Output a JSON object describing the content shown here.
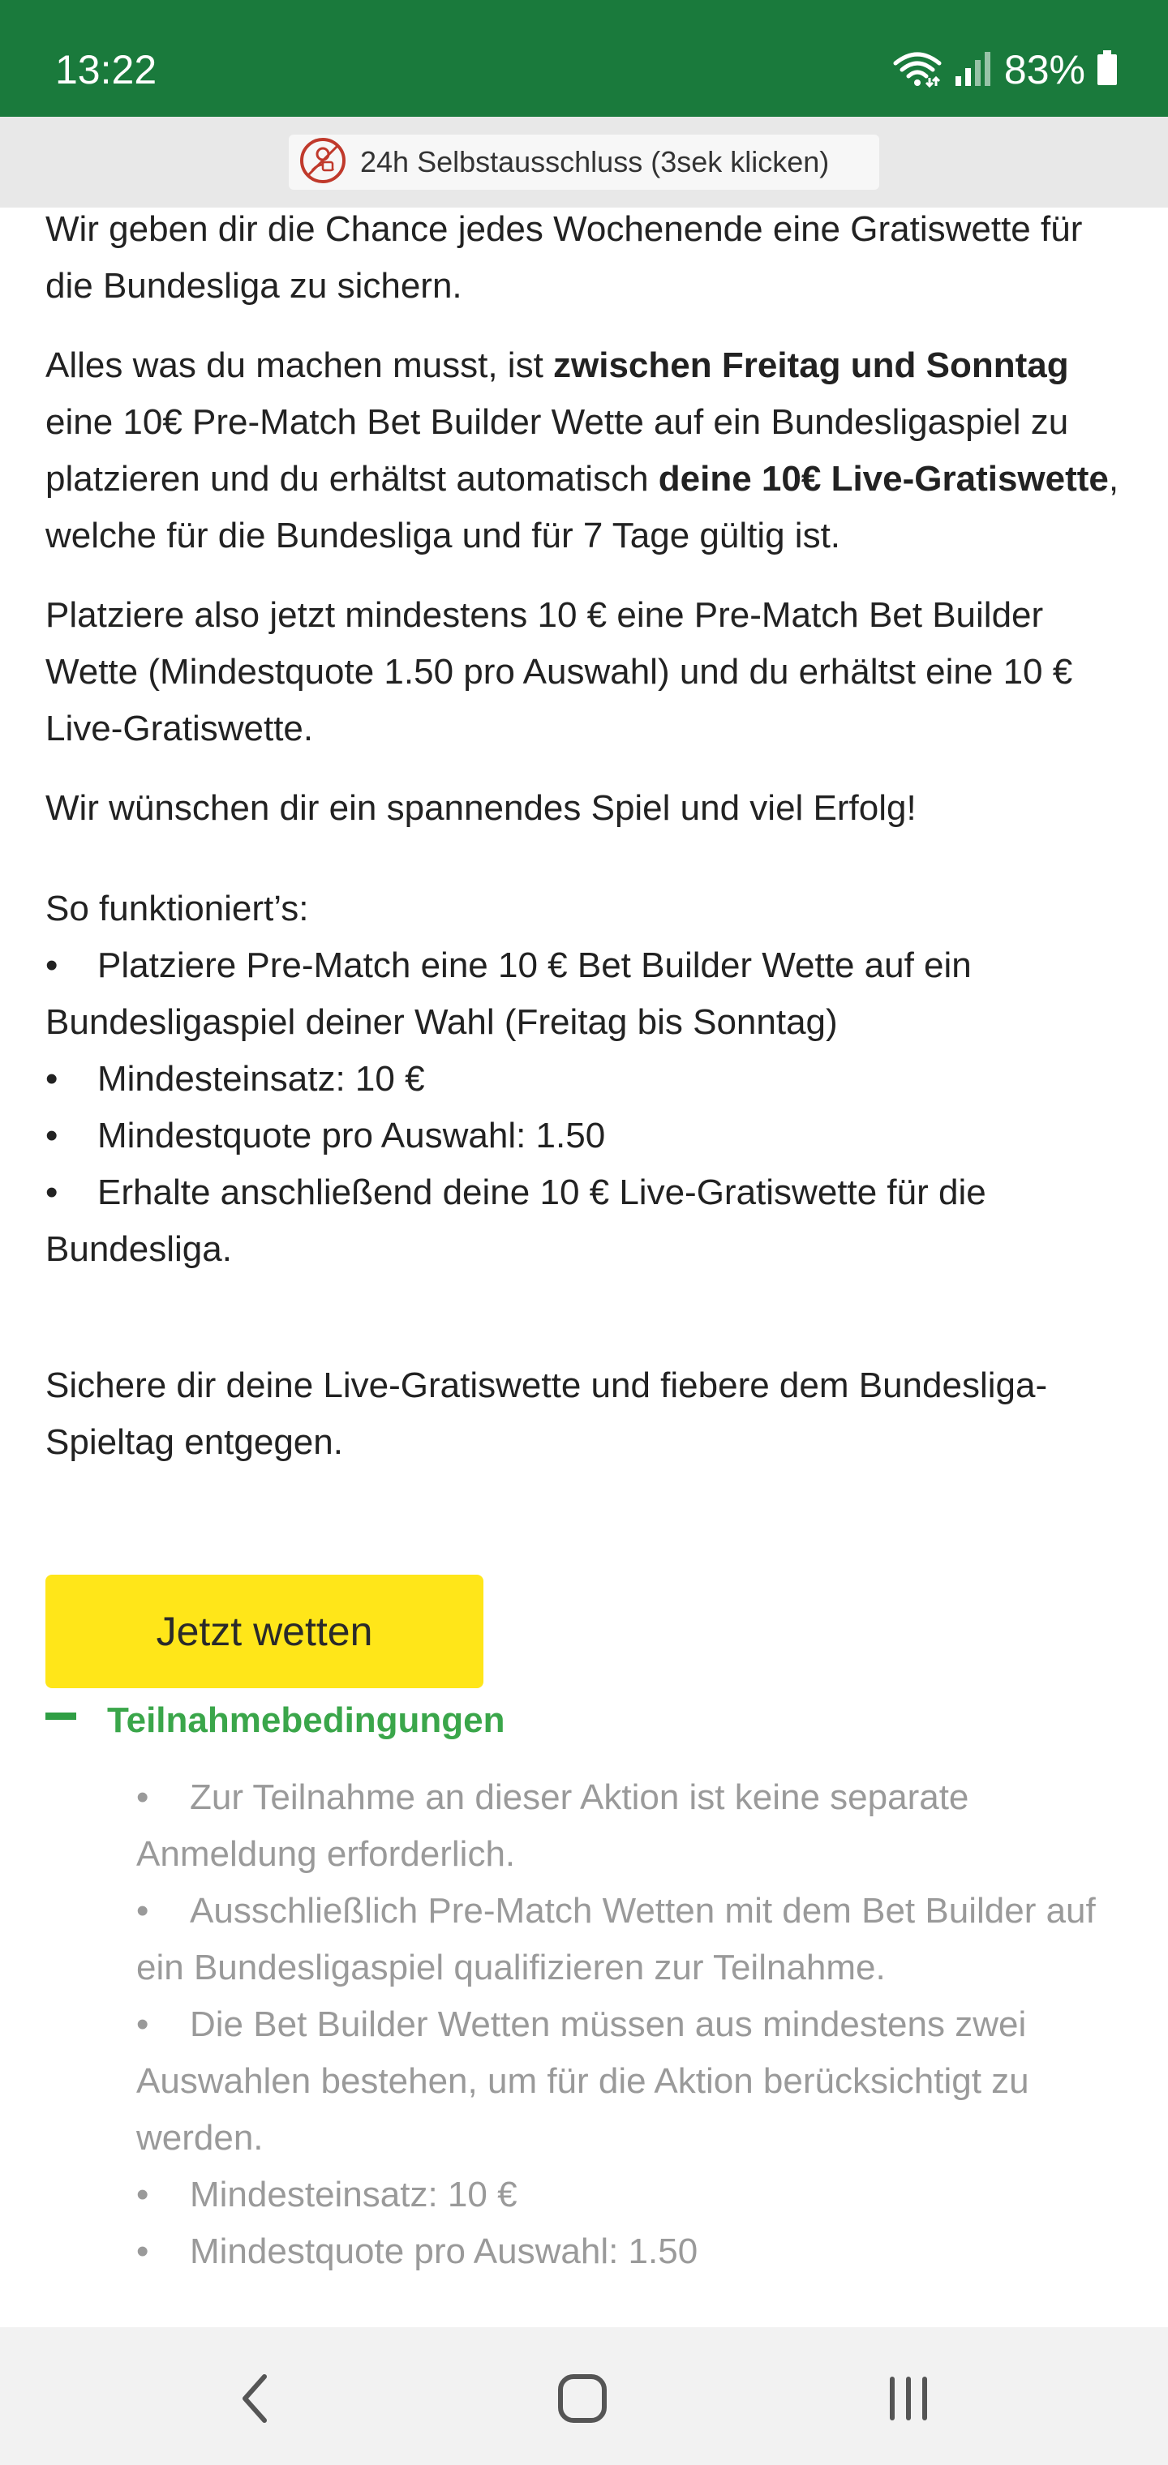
{
  "status_bar": {
    "time": "13:22",
    "battery": "83%",
    "icons": [
      "wifi-icon",
      "signal-icon",
      "battery-icon"
    ]
  },
  "self_exclusion": {
    "icon": "self-exclusion-icon",
    "label": "24h Selbstausschluss (3sek klicken)"
  },
  "content": {
    "p1": "Wir geben dir die Chance jedes Wochenende eine Gratiswette für die Bundesliga zu sichern.",
    "p2": {
      "t1": "Alles was du machen musst, ist ",
      "b1": "zwischen Freitag und Sonntag",
      "t2": " eine 10€ Pre-Match Bet Builder Wette auf ein Bundesligaspiel zu platzieren und du erhältst automatisch ",
      "b2": "deine 10€ Live-Gratiswette",
      "t3": ", welche für die Bundesliga und für 7 Tage gültig ist."
    },
    "p3": "Platziere also jetzt mindestens 10 € eine Pre-Match Bet Builder Wette (Mindestquote 1.50 pro Auswahl) und du erhältst eine 10 € Live-Gratiswette.",
    "p4": "Wir wünschen dir ein spannendes Spiel und viel Erfolg!",
    "how_title": "So funktioniert’s:",
    "bullet": "•",
    "how_items": [
      "Platziere Pre-Match eine 10 € Bet Builder Wette auf ein Bundesligaspiel deiner Wahl (Freitag bis Sonntag)",
      "Mindesteinsatz: 10 €",
      "Mindestquote pro Auswahl: 1.50",
      "Erhalte anschließend deine 10 € Live-Gratiswette für die Bundesliga."
    ],
    "closing": "Sichere dir deine Live-Gratiswette und fiebere dem Bundesliga-Spieltag entgegen."
  },
  "cta": {
    "label": "Jetzt wetten"
  },
  "terms": {
    "label": "Teilnahmebedingungen",
    "items": [
      "Zur Teilnahme an dieser Aktion ist keine separate Anmeldung erforderlich.",
      "Ausschließlich Pre-Match Wetten mit dem Bet Builder auf ein Bundesligaspiel qualifizieren zur Teilnahme.",
      "Die Bet Builder Wetten müssen aus mindestens zwei Auswahlen bestehen, um für die Aktion berücksichtigt zu werden.",
      "Mindesteinsatz: 10 €",
      "Mindestquote pro Auswahl: 1.50"
    ]
  },
  "nav": {
    "icons": [
      "back-icon",
      "home-icon",
      "recents-icon"
    ]
  },
  "colors": {
    "status_bar": "#1a7a3c",
    "cta": "#ffe619",
    "terms_accent": "#3aa64a",
    "muted_text": "#9a9a9a"
  }
}
